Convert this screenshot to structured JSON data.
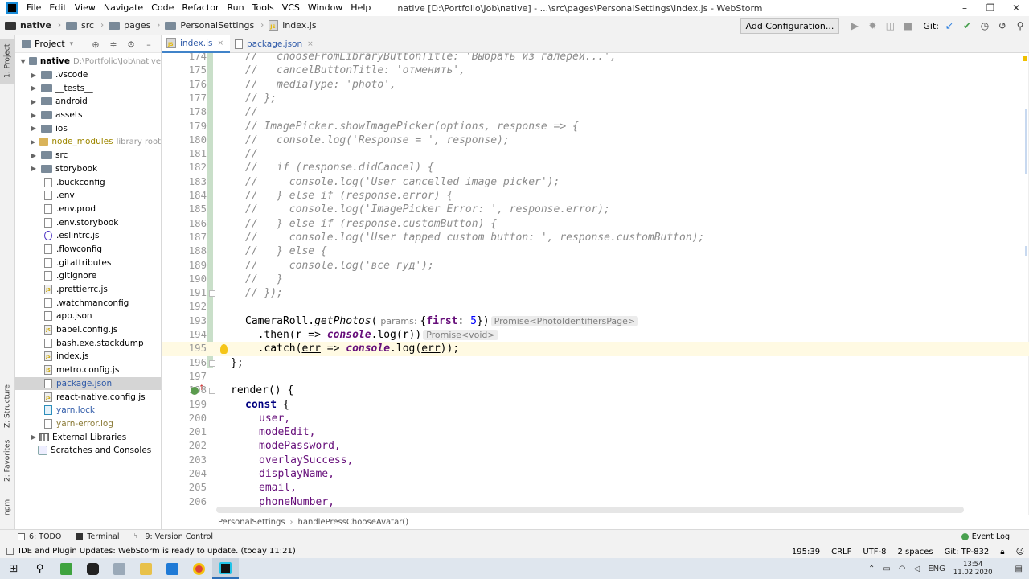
{
  "menubar": {
    "items": [
      "File",
      "Edit",
      "View",
      "Navigate",
      "Code",
      "Refactor",
      "Run",
      "Tools",
      "VCS",
      "Window",
      "Help"
    ],
    "window_title": "native [D:\\Portfolio\\Job\\native] - ...\\src\\pages\\PersonalSettings\\index.js - WebStorm",
    "controls": [
      "–",
      "❐",
      "✕"
    ]
  },
  "navbar": {
    "crumbs": [
      "native",
      "src",
      "pages",
      "PersonalSettings",
      "index.js"
    ],
    "add_config": "Add Configuration...",
    "git_label": "Git:"
  },
  "left_stripe": {
    "project": "1: Project",
    "structure": "Z: Structure",
    "favorites": "2: Favorites",
    "npm": "npm"
  },
  "project_panel": {
    "title": "Project",
    "root_name": "native",
    "root_path": "D:\\Portfolio\\Job\\native",
    "folders": [
      ".vscode",
      "__tests__",
      "android",
      "assets",
      "ios",
      "node_modules",
      "src",
      "storybook"
    ],
    "node_modules_note": "library root",
    "files": [
      ".buckconfig",
      ".env",
      ".env.prod",
      ".env.storybook",
      ".eslintrc.js",
      ".flowconfig",
      ".gitattributes",
      ".gitignore",
      ".prettierrc.js",
      ".watchmanconfig",
      "app.json",
      "babel.config.js",
      "bash.exe.stackdump",
      "index.js",
      "metro.config.js",
      "package.json",
      "react-native.config.js",
      "yarn.lock",
      "yarn-error.log"
    ],
    "external_libraries": "External Libraries",
    "scratches": "Scratches and Consoles"
  },
  "editor_tabs": [
    {
      "label": "index.js",
      "close": "×"
    },
    {
      "label": "package.json",
      "close": "×"
    }
  ],
  "editor": {
    "line_numbers": [
      "174",
      "175",
      "176",
      "177",
      "178",
      "179",
      "180",
      "181",
      "182",
      "183",
      "184",
      "185",
      "186",
      "187",
      "188",
      "189",
      "190",
      "191",
      "192",
      "193",
      "194",
      "195",
      "196",
      "197",
      "198",
      "199",
      "200",
      "201",
      "202",
      "203",
      "204",
      "205",
      "206"
    ],
    "comment_lines": [
      "//   chooseFromLibraryButtonTitle: 'Выбрать из галереи...',",
      "//   cancelButtonTitle: 'отменить',",
      "//   mediaType: 'photo',",
      "// };",
      "//",
      "// ImagePicker.showImagePicker(options, response => {",
      "//   console.log('Response = ', response);",
      "//",
      "//   if (response.didCancel) {",
      "//     console.log('User cancelled image picker');",
      "//   } else if (response.error) {",
      "//     console.log('ImagePicker Error: ', response.error);",
      "//   } else if (response.customButton) {",
      "//     console.log('User tapped custom button: ', response.customButton);",
      "//   } else {",
      "//     console.log('все гуд');",
      "//   }",
      "// });"
    ],
    "l193": {
      "obj": "CameraRoll",
      "dot": ".",
      "method": "getPhotos",
      "open": "(",
      "param_hint": "params:",
      "arg_open": "{",
      "arg_key": "first",
      "arg_colon": ": ",
      "arg_val": "5",
      "arg_close": "})",
      "type_hint": "Promise<PhotoIdentifiersPage>"
    },
    "l194": {
      "indent": "  ",
      "pre": ".then(",
      "p": "r",
      "arrow": " => ",
      "glob": "console",
      "dot": ".",
      "fn": "log",
      "o": "(",
      "a": "r",
      "c": "))",
      "type_hint": "Promise<void>"
    },
    "l195": {
      "indent": "  ",
      "pre": ".catch(",
      "p": "err",
      "arrow": " => ",
      "glob": "console",
      "dot": ".",
      "fn": "log",
      "o": "(",
      "a": "err",
      "c": "));"
    },
    "l196": "};",
    "l198": {
      "fn": "render",
      "rest": "() {"
    },
    "l199": {
      "kw": "const",
      "rest": " {"
    },
    "props": [
      "user,",
      "modeEdit,",
      "modePassword,",
      "overlaySuccess,",
      "displayName,",
      "email,",
      "phoneNumber,"
    ]
  },
  "code_breadcrumbs": [
    "PersonalSettings",
    "handlePressChooseAvatar()"
  ],
  "bottom_tabs": [
    "6: TODO",
    "Terminal",
    "9: Version Control"
  ],
  "event_log": "Event Log",
  "status": {
    "message": "IDE and Plugin Updates: WebStorm is ready to update. (today 11:21)",
    "position": "195:39",
    "line_sep": "CRLF",
    "encoding": "UTF-8",
    "indent": "2 spaces",
    "git": "Git: TP-832"
  },
  "taskbar": {
    "lang": "ENG",
    "time": "13:54",
    "date": "11.02.2020"
  },
  "colors": {
    "accent": "#4083c9",
    "comment": "#8c8c8c",
    "keyword": "#000080",
    "property": "#660e7a",
    "number": "#0000ff",
    "current_line": "#fffae3"
  }
}
